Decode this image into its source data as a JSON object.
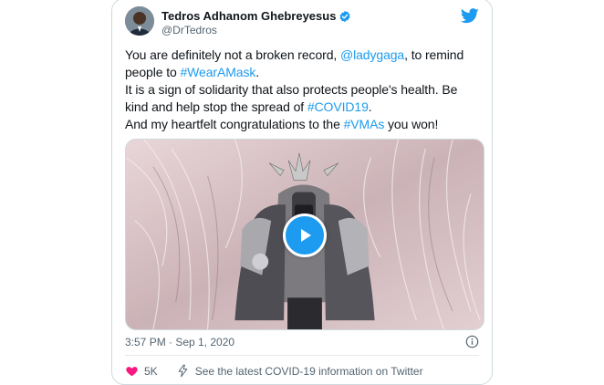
{
  "author": {
    "name": "Tedros Adhanom Ghebreyesus",
    "handle": "@DrTedros"
  },
  "tweet": {
    "line1": {
      "text_before": "You are definitely not a broken record, ",
      "mention": "@ladygaga",
      "text_after": ", to remind"
    },
    "line2": {
      "text_before": "people to ",
      "hashtag": "#WearAMask",
      "text_after": "."
    },
    "line3": {
      "text": "It is a sign of solidarity that also protects people's health. Be"
    },
    "line4": {
      "text_before": "kind and help stop the spread of ",
      "hashtag": "#COVID19",
      "text_after": "."
    },
    "line5": {
      "text_before": "And my heartfelt congratulations to the ",
      "hashtag": "#VMAs",
      "text_after": " you won!"
    }
  },
  "media": {
    "type": "video",
    "icon": "play-icon"
  },
  "timestamp": "3:57 PM · Sep 1, 2020",
  "actions": {
    "like_count": "5K",
    "info_link": "See the latest COVID-19 information on Twitter"
  },
  "colors": {
    "accent": "#1d9bf0",
    "text": "#0f1419",
    "secondary": "#536471",
    "border": "#cfd9de",
    "like": "#f91880"
  },
  "icons": [
    "verified-badge-icon",
    "twitter-bird-icon",
    "play-icon",
    "info-icon",
    "heart-icon",
    "lightning-icon"
  ]
}
